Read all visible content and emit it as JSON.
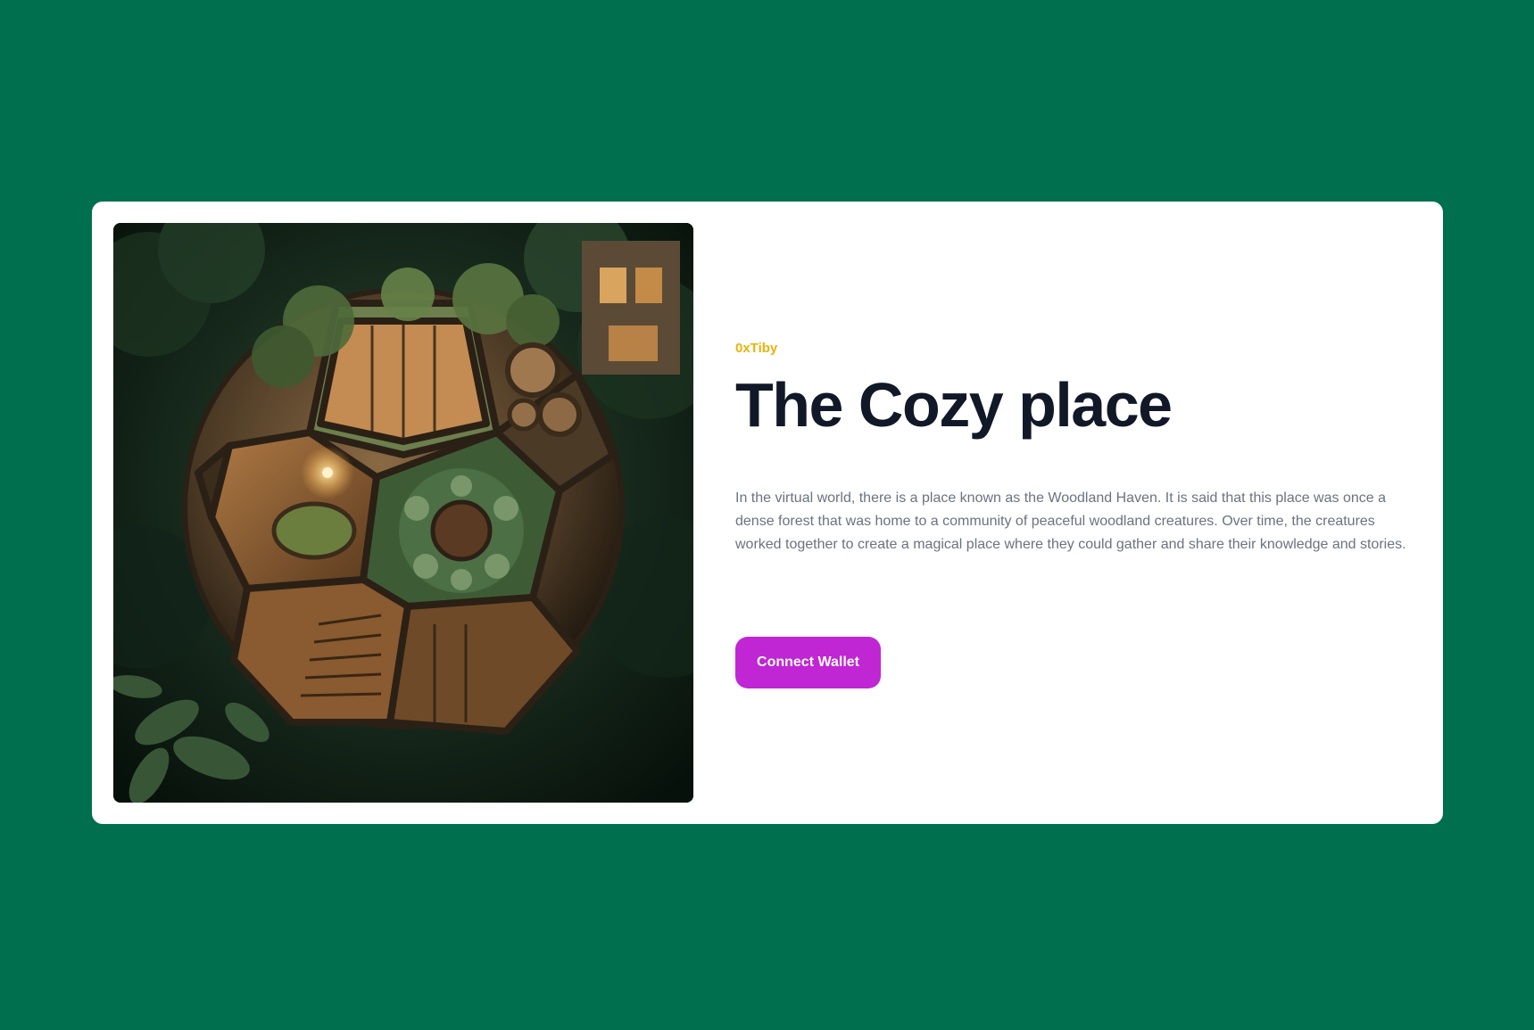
{
  "card": {
    "collection_name": "0xTiby",
    "title": "The Cozy place",
    "description": "In the virtual world, there is a place known as the Woodland Haven. It is said that this place was once a dense forest that was home to a community of peaceful woodland creatures. Over time, the creatures worked together to create a magical place where they could gather and share their knowledge and stories.",
    "button_label": "Connect Wallet"
  },
  "colors": {
    "background": "#006f4e",
    "card": "#ffffff",
    "accent_collection": "#eab308",
    "title": "#111827",
    "body_text": "#6b7280",
    "button": "#c026d3"
  }
}
